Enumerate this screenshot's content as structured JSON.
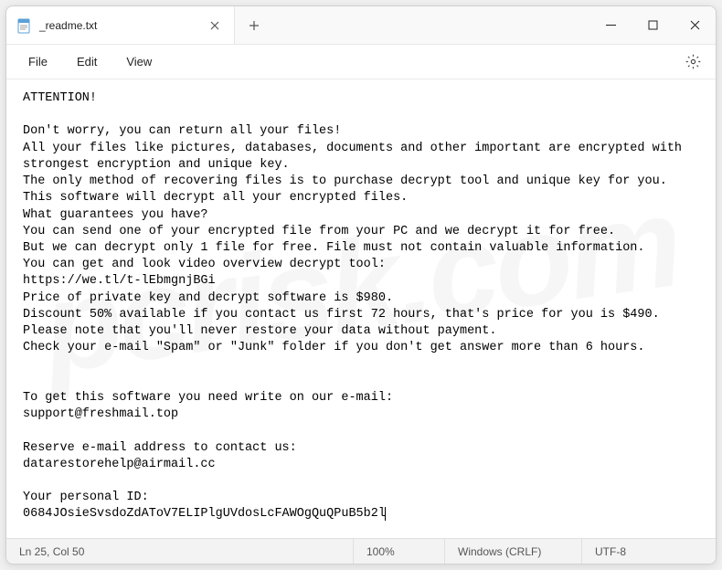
{
  "tab": {
    "title": "_readme.txt"
  },
  "menu": {
    "file": "File",
    "edit": "Edit",
    "view": "View"
  },
  "content": {
    "text": "ATTENTION!\n\nDon't worry, you can return all your files!\nAll your files like pictures, databases, documents and other important are encrypted with strongest encryption and unique key.\nThe only method of recovering files is to purchase decrypt tool and unique key for you.\nThis software will decrypt all your encrypted files.\nWhat guarantees you have?\nYou can send one of your encrypted file from your PC and we decrypt it for free.\nBut we can decrypt only 1 file for free. File must not contain valuable information.\nYou can get and look video overview decrypt tool:\nhttps://we.tl/t-lEbmgnjBGi\nPrice of private key and decrypt software is $980.\nDiscount 50% available if you contact us first 72 hours, that's price for you is $490.\nPlease note that you'll never restore your data without payment.\nCheck your e-mail \"Spam\" or \"Junk\" folder if you don't get answer more than 6 hours.\n\n\nTo get this software you need write on our e-mail:\nsupport@freshmail.top\n\nReserve e-mail address to contact us:\ndatarestorehelp@airmail.cc\n\nYour personal ID:\n0684JOsieSvsdoZdAToV7ELIPlgUVdosLcFAWOgQuQPuB5b2l"
  },
  "status": {
    "position": "Ln 25, Col 50",
    "zoom": "100%",
    "eol": "Windows (CRLF)",
    "encoding": "UTF-8"
  },
  "watermark": "pcrisk.com"
}
